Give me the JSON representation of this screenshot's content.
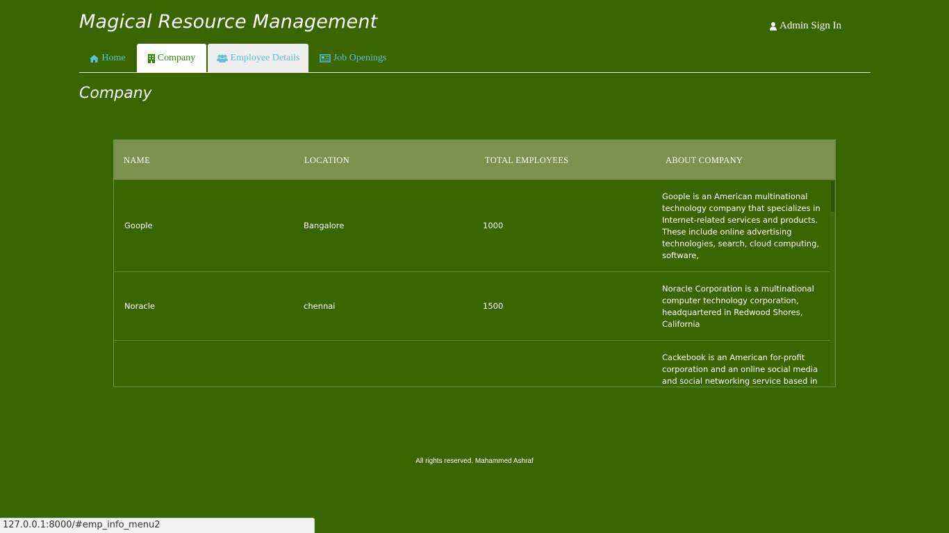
{
  "header": {
    "site_title": "Magical Resource Management",
    "admin_signin_label": "Admin Sign In",
    "admin_icon": "user-icon"
  },
  "nav": {
    "tabs": [
      {
        "label": "Home",
        "icon": "home-icon",
        "active": false
      },
      {
        "label": "Company",
        "icon": "building-icon",
        "active": true
      },
      {
        "label": "Employee Details",
        "icon": "users-icon",
        "active": false
      },
      {
        "label": "Job Openings",
        "icon": "newspaper-icon",
        "active": false
      }
    ]
  },
  "main": {
    "section_title": "Company",
    "table": {
      "columns": [
        "NAME",
        "LOCATION",
        "TOTAL EMPLOYEES",
        "ABOUT COMPANY"
      ],
      "rows": [
        {
          "name": "Goople",
          "location": "Bangalore",
          "total_employees": "1000",
          "about": "Goople is an American multinational technology company that specializes in Internet-related services and products. These include online advertising technologies, search, cloud computing, software,"
        },
        {
          "name": "Noracle",
          "location": "chennai",
          "total_employees": "1500",
          "about": "Noracle Corporation is a multinational computer technology corporation, headquartered in Redwood Shores, California"
        },
        {
          "name": "",
          "location": "",
          "total_employees": "",
          "about": "Cackebook is an American for-profit corporation and an online social media and social networking service based in"
        }
      ]
    }
  },
  "footer": {
    "text": "All rights reserved. Mahammed Ashraf"
  },
  "statusbar": {
    "url": "127.0.0.1:8000/#emp_info_menu2"
  },
  "colors": {
    "background": "#396600",
    "table_header": "#7a924e",
    "tab_link": "#5bc0de",
    "active_tab_text": "#2a8a00"
  }
}
